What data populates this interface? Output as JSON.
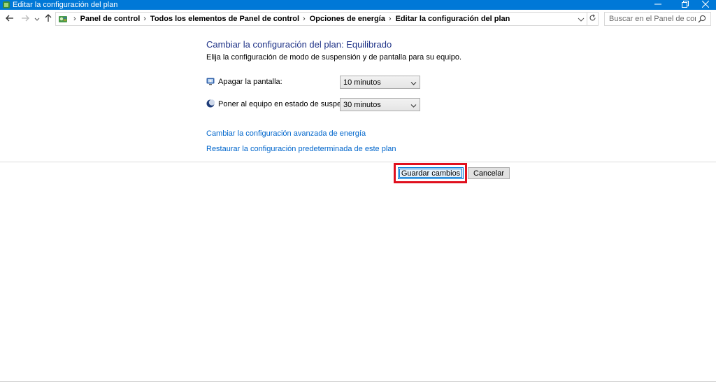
{
  "window": {
    "title": "Editar la configuración del plan",
    "icons": [
      "app-icon",
      "minimize-icon",
      "restore-icon",
      "close-icon"
    ]
  },
  "nav": {
    "crumbs": [
      "Panel de control",
      "Todos los elementos de Panel de control",
      "Opciones de energía",
      "Editar la configuración del plan"
    ],
    "search_placeholder": "Buscar en el Panel de control"
  },
  "main": {
    "title": "Cambiar la configuración del plan: Equilibrado",
    "subtitle": "Elija la configuración de modo de suspensión y de pantalla para su equipo.",
    "settings": [
      {
        "label": "Apagar la pantalla:",
        "value": "10 minutos",
        "icon": "monitor-icon"
      },
      {
        "label": "Poner al equipo en estado de suspensión:",
        "value": "30 minutos",
        "icon": "moon-icon"
      }
    ],
    "links": [
      "Cambiar la configuración avanzada de energía",
      "Restaurar la configuración predeterminada de este plan"
    ]
  },
  "buttons": {
    "save": "Guardar cambios",
    "cancel": "Cancelar"
  },
  "colors": {
    "titlebar": "#0078d7",
    "title_text": "#1e3287",
    "link": "#0066cc",
    "highlight": "#e0101e"
  }
}
